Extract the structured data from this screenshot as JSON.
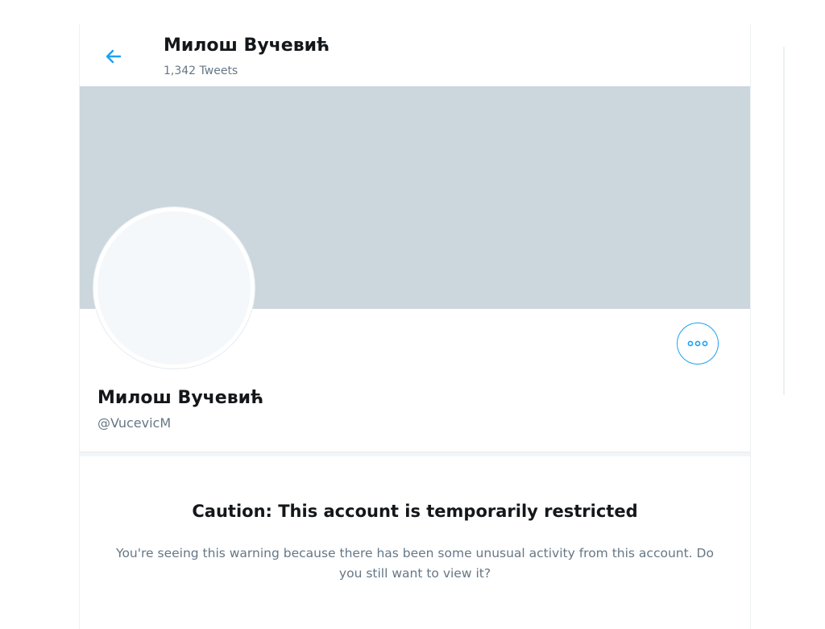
{
  "header": {
    "back_icon": "arrow-left-icon",
    "name": "Милош Вучевић",
    "tweet_count": "1,342 Tweets"
  },
  "profile": {
    "name": "Милош Вучевић",
    "handle": "@VucevicM",
    "more_icon": "more-horizontal-icon"
  },
  "caution": {
    "title": "Caution: This account is temporarily restricted",
    "message": "You're seeing this warning because there has been some unusual activity from this account. Do you still want to view it?"
  },
  "colors": {
    "accent": "#1da1f2",
    "banner": "#ccd6dd",
    "text_primary": "#14171a",
    "text_secondary": "#657786"
  }
}
